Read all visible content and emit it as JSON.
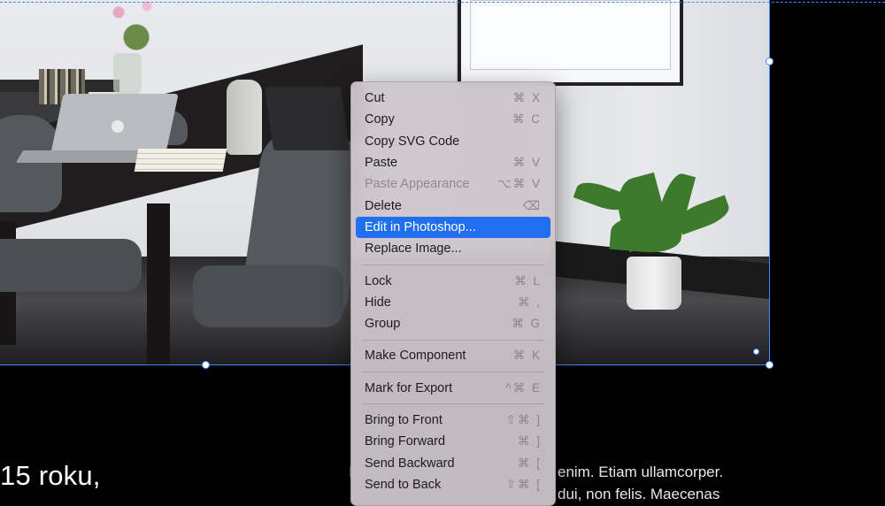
{
  "context_menu": {
    "groups": [
      [
        {
          "label": "Cut",
          "shortcut": "⌘ X",
          "disabled": false
        },
        {
          "label": "Copy",
          "shortcut": "⌘ C",
          "disabled": false
        },
        {
          "label": "Copy SVG Code",
          "shortcut": "",
          "disabled": false
        },
        {
          "label": "Paste",
          "shortcut": "⌘ V",
          "disabled": false
        },
        {
          "label": "Paste Appearance",
          "shortcut": "⌥⌘ V",
          "disabled": true
        },
        {
          "label": "Delete",
          "shortcut": "⌫",
          "disabled": false
        },
        {
          "label": "Edit in Photoshop...",
          "shortcut": "",
          "disabled": false,
          "highlighted": true
        },
        {
          "label": "Replace Image...",
          "shortcut": "",
          "disabled": false
        }
      ],
      [
        {
          "label": "Lock",
          "shortcut": "⌘ L",
          "disabled": false
        },
        {
          "label": "Hide",
          "shortcut": "⌘ ,",
          "disabled": false
        },
        {
          "label": "Group",
          "shortcut": "⌘ G",
          "disabled": false
        }
      ],
      [
        {
          "label": "Make Component",
          "shortcut": "⌘ K",
          "disabled": false
        }
      ],
      [
        {
          "label": "Mark for Export",
          "shortcut": "^⌘ E",
          "disabled": false
        }
      ],
      [
        {
          "label": "Bring to Front",
          "shortcut": "⇧⌘ ]",
          "disabled": false
        },
        {
          "label": "Bring Forward",
          "shortcut": "⌘ ]",
          "disabled": false
        },
        {
          "label": "Send Backward",
          "shortcut": "⌘ [",
          "disabled": false
        },
        {
          "label": "Send to Back",
          "shortcut": "⇧⌘ [",
          "disabled": false
        }
      ]
    ]
  },
  "canvas": {
    "heading_fragment": "15 roku,",
    "paragraph_line1": "enim. Etiam ullamcorper.",
    "paragraph_line2": "dui, non felis. Maecenas",
    "paragraph_left_edge": "I"
  },
  "colors": {
    "accent": "#1f6ff0",
    "selection": "#3d8bfd",
    "canvas_background": "#000000"
  }
}
